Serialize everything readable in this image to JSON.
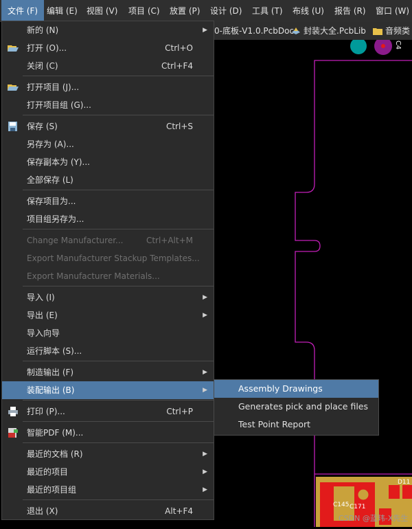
{
  "menubar": [
    {
      "label": "文件 (F)",
      "active": true
    },
    {
      "label": "编辑 (E)"
    },
    {
      "label": "视图 (V)"
    },
    {
      "label": "项目 (C)"
    },
    {
      "label": "放置 (P)"
    },
    {
      "label": "设计 (D)"
    },
    {
      "label": "工具 (T)"
    },
    {
      "label": "布线 (U)"
    },
    {
      "label": "报告 (R)"
    },
    {
      "label": "窗口 (W)"
    }
  ],
  "tabs": [
    {
      "label": "0-底板-V1.0.PcbDoc"
    },
    {
      "label": "封装大全.PcbLib",
      "icon": "pcblib-icon"
    },
    {
      "label": "音频类",
      "icon": "folder-icon"
    }
  ],
  "file_menu": [
    {
      "label": "新的 (N)",
      "shortcut": "",
      "submenu": true
    },
    {
      "label": "打开 (O)...",
      "shortcut": "Ctrl+O",
      "icon": "open-folder-icon"
    },
    {
      "label": "关闭 (C)",
      "shortcut": "Ctrl+F4"
    },
    {
      "label": "打开项目 (J)...",
      "shortcut": "",
      "icon": "open-project-icon"
    },
    {
      "label": "打开项目组 (G)...",
      "shortcut": ""
    },
    {
      "label": "保存 (S)",
      "shortcut": "Ctrl+S",
      "icon": "save-icon"
    },
    {
      "label": "另存为 (A)...",
      "shortcut": ""
    },
    {
      "label": "保存副本为 (Y)...",
      "shortcut": ""
    },
    {
      "label": "全部保存 (L)",
      "shortcut": ""
    },
    {
      "label": "保存项目为...",
      "shortcut": ""
    },
    {
      "label": "项目组另存为...",
      "shortcut": ""
    },
    {
      "label": "Change Manufacturer...",
      "shortcut": "Ctrl+Alt+M",
      "disabled": true
    },
    {
      "label": "Export Manufacturer Stackup Templates...",
      "shortcut": "",
      "disabled": true
    },
    {
      "label": "Export Manufacturer Materials...",
      "shortcut": "",
      "disabled": true
    },
    {
      "label": "导入 (I)",
      "shortcut": "",
      "submenu": true
    },
    {
      "label": "导出 (E)",
      "shortcut": "",
      "submenu": true
    },
    {
      "label": "导入向导",
      "shortcut": ""
    },
    {
      "label": "运行脚本 (S)...",
      "shortcut": ""
    },
    {
      "label": "制造输出 (F)",
      "shortcut": "",
      "submenu": true
    },
    {
      "label": "装配输出 (B)",
      "shortcut": "",
      "submenu": true,
      "highlighted": true
    },
    {
      "label": "打印 (P)...",
      "shortcut": "Ctrl+P",
      "icon": "printer-icon"
    },
    {
      "label": "智能PDF (M)...",
      "shortcut": "",
      "icon": "pdf-icon"
    },
    {
      "label": "最近的文档 (R)",
      "shortcut": "",
      "submenu": true
    },
    {
      "label": "最近的项目",
      "shortcut": "",
      "submenu": true
    },
    {
      "label": "最近的项目组",
      "shortcut": "",
      "submenu": true
    },
    {
      "label": "退出 (X)",
      "shortcut": "Alt+F4"
    }
  ],
  "assembly_submenu": [
    {
      "label": "Assembly Drawings",
      "highlighted": true
    },
    {
      "label": "Generates pick and place files"
    },
    {
      "label": "Test Point Report"
    }
  ],
  "pcb": {
    "tag": "C4",
    "designators": [
      "C145",
      "C171",
      "D11"
    ]
  },
  "watermark": "CSDN @蓝玮-X先生",
  "colors": {
    "accent": "#4f7aa6",
    "board_outline": "#c21fb8",
    "copper": "#e21b1b",
    "silk": "#c9a23b",
    "pad_teal": "#009a9a"
  }
}
